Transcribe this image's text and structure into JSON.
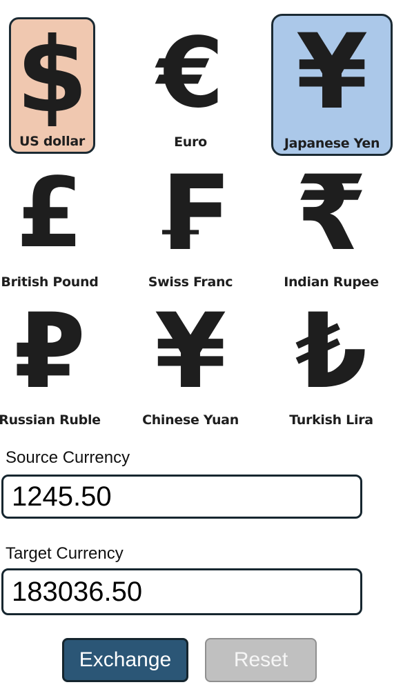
{
  "colors": {
    "source_highlight": "#f0c8b0",
    "target_highlight": "#abc8e9",
    "exchange_button": "#2b5676",
    "reset_button": "#c0c0c0"
  },
  "currencies": [
    {
      "symbol": "$",
      "name": "US dollar",
      "selected": "source"
    },
    {
      "symbol": "€",
      "name": "Euro",
      "selected": ""
    },
    {
      "symbol": "¥",
      "name": "Japanese Yen",
      "selected": "target"
    },
    {
      "symbol": "£",
      "name": "British Pound",
      "selected": ""
    },
    {
      "symbol": "₣",
      "name": "Swiss Franc",
      "selected": ""
    },
    {
      "symbol": "₹",
      "name": "Indian Rupee",
      "selected": ""
    },
    {
      "symbol": "₽",
      "name": "Russian Ruble",
      "selected": ""
    },
    {
      "symbol": "¥",
      "name": "Chinese Yuan",
      "selected": ""
    },
    {
      "symbol": "₺",
      "name": "Turkish Lira",
      "selected": ""
    }
  ],
  "source": {
    "label": "Source Currency",
    "value": "1245.50"
  },
  "target": {
    "label": "Target Currency",
    "value": "183036.50"
  },
  "buttons": {
    "exchange": "Exchange",
    "reset": "Reset"
  }
}
